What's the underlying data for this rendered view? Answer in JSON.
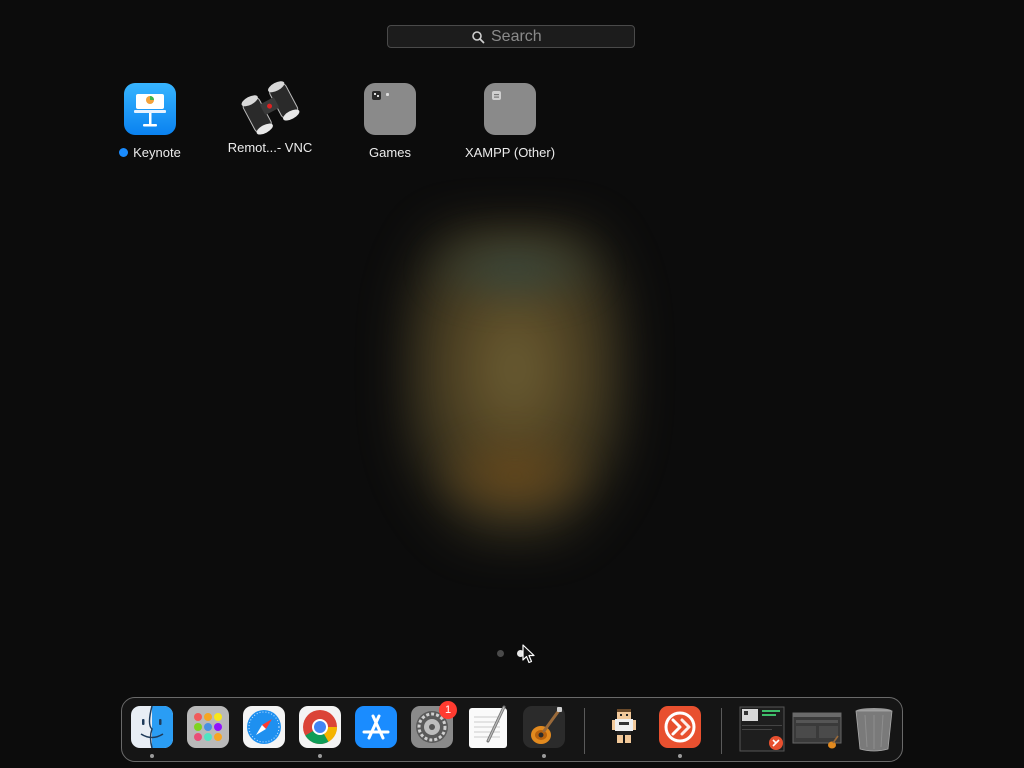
{
  "search": {
    "placeholder": "Search"
  },
  "apps": [
    {
      "label": "Keynote",
      "icon": "keynote-icon",
      "is_new": true
    },
    {
      "label": "Remot...- VNC",
      "icon": "binoculars-icon"
    },
    {
      "label": "Games",
      "icon": "folder-icon"
    },
    {
      "label": "XAMPP (Other)",
      "icon": "folder-icon"
    }
  ],
  "pagination": {
    "pages": 2,
    "current": 2
  },
  "dock": {
    "items": [
      {
        "name": "Finder",
        "icon": "finder-icon",
        "running": true
      },
      {
        "name": "Launchpad",
        "icon": "launchpad-icon"
      },
      {
        "name": "Safari",
        "icon": "safari-icon"
      },
      {
        "name": "Google Chrome",
        "icon": "chrome-icon",
        "running": true
      },
      {
        "name": "App Store",
        "icon": "app-store-icon"
      },
      {
        "name": "System Preferences",
        "icon": "system-preferences-icon",
        "badge": "1"
      },
      {
        "name": "TextEdit",
        "icon": "textedit-icon"
      },
      {
        "name": "GarageBand",
        "icon": "garageband-icon",
        "running": true
      },
      {
        "name": "Pixel Character",
        "icon": "pixel-character-icon"
      },
      {
        "name": "Microsoft Remote Desktop",
        "icon": "remote-desktop-icon",
        "running": true
      },
      {
        "name": "Minimized Window 1",
        "icon": "window-thumbnail-icon"
      },
      {
        "name": "Minimized Window 2",
        "icon": "window-thumbnail-icon"
      },
      {
        "name": "Trash",
        "icon": "trash-icon"
      }
    ]
  },
  "colors": {
    "background": "#0c0c0c",
    "accent_new_dot": "#1a8cff",
    "badge": "#ff3b30"
  }
}
